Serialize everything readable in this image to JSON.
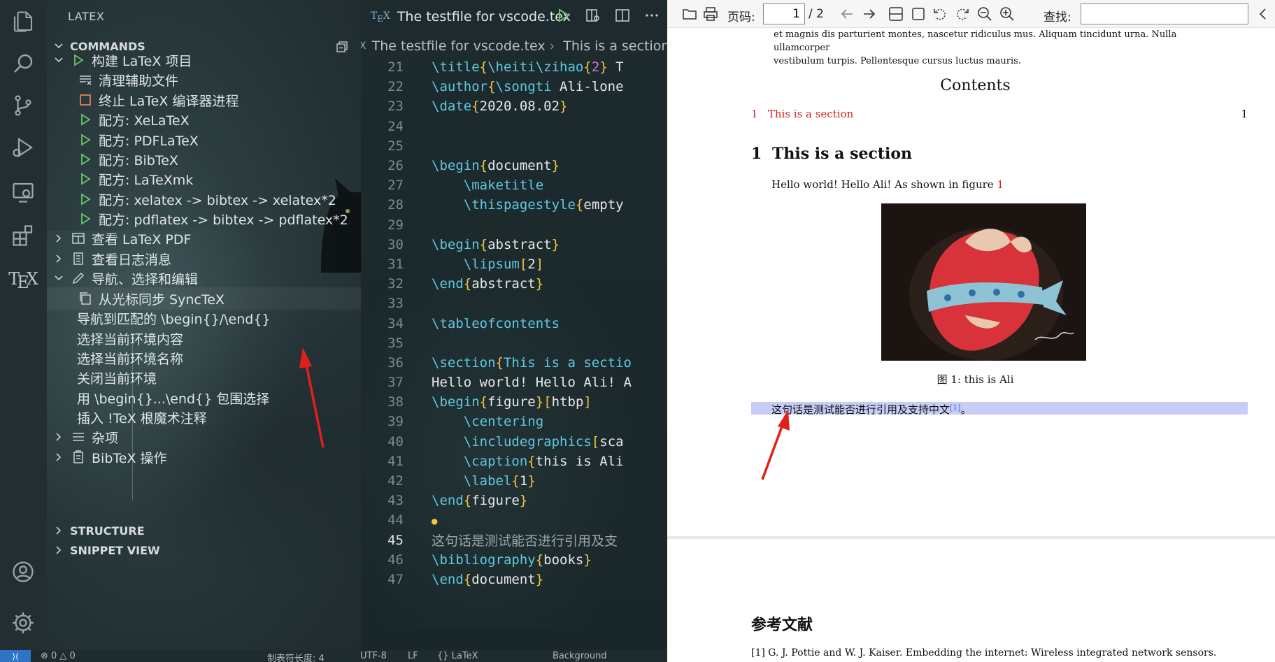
{
  "sidebar": {
    "title": "LATEX",
    "more": "···",
    "commands_header": "COMMANDS",
    "items": [
      {
        "label": "构建 LaTeX 项目"
      },
      {
        "label": "清理辅助文件"
      },
      {
        "label": "终止 LaTeX 编译器进程"
      },
      {
        "label": "配方: XeLaTeX"
      },
      {
        "label": "配方: PDFLaTeX"
      },
      {
        "label": "配方: BibTeX"
      },
      {
        "label": "配方: LaTeXmk"
      },
      {
        "label": "配方: xelatex -> bibtex -> xelatex*2"
      },
      {
        "label": "配方: pdflatex -> bibtex -> pdflatex*2"
      },
      {
        "label": "查看 LaTeX PDF"
      },
      {
        "label": "查看日志消息"
      },
      {
        "label": "导航、选择和编辑"
      },
      {
        "label": "从光标同步 SyncTeX"
      },
      {
        "label": "导航到匹配的 \\begin{}/\\end{}"
      },
      {
        "label": "选择当前环境内容"
      },
      {
        "label": "选择当前环境名称"
      },
      {
        "label": "关闭当前环境"
      },
      {
        "label": "用 \\begin{}...\\end{} 包围选择"
      },
      {
        "label": "插入 !TeX 根魔术注释"
      },
      {
        "label": "杂项"
      },
      {
        "label": "BibTeX 操作"
      }
    ],
    "structure_header": "STRUCTURE",
    "snippet_header": "SNIPPET VIEW"
  },
  "editor": {
    "tab_title": "The testfile for vscode.tex",
    "breadcrumb_file": "The testfile for vscode.tex",
    "breadcrumb_section": "This is a section",
    "lines": [
      {
        "n": "21",
        "tokens": [
          [
            "c",
            "\\title"
          ],
          [
            "b",
            "{"
          ],
          [
            "c",
            "\\heiti"
          ],
          [
            "c",
            "\\zihao"
          ],
          [
            "b",
            "{"
          ],
          [
            "p",
            "2"
          ],
          [
            "b",
            "}"
          ],
          [
            "t",
            " T"
          ]
        ]
      },
      {
        "n": "22",
        "tokens": [
          [
            "c",
            "\\author"
          ],
          [
            "b",
            "{"
          ],
          [
            "c",
            "\\songti"
          ],
          [
            "t",
            " Ali-lone"
          ]
        ]
      },
      {
        "n": "23",
        "tokens": [
          [
            "c",
            "\\date"
          ],
          [
            "b",
            "{"
          ],
          [
            "t",
            "2020.08.02"
          ],
          [
            "b",
            "}"
          ]
        ]
      },
      {
        "n": "24",
        "tokens": []
      },
      {
        "n": "25",
        "tokens": []
      },
      {
        "n": "26",
        "tokens": [
          [
            "c",
            "\\begin"
          ],
          [
            "b",
            "{"
          ],
          [
            "t",
            "document"
          ],
          [
            "b",
            "}"
          ]
        ]
      },
      {
        "n": "27",
        "tokens": [
          [
            "t",
            "    "
          ],
          [
            "c",
            "\\maketitle"
          ]
        ]
      },
      {
        "n": "28",
        "tokens": [
          [
            "t",
            "    "
          ],
          [
            "c",
            "\\thispagestyle"
          ],
          [
            "b",
            "{"
          ],
          [
            "t",
            "empty"
          ]
        ]
      },
      {
        "n": "29",
        "tokens": []
      },
      {
        "n": "30",
        "tokens": [
          [
            "c",
            "\\begin"
          ],
          [
            "b",
            "{"
          ],
          [
            "t",
            "abstract"
          ],
          [
            "b",
            "}"
          ]
        ]
      },
      {
        "n": "31",
        "tokens": [
          [
            "t",
            "    "
          ],
          [
            "c",
            "\\lipsum"
          ],
          [
            "b",
            "["
          ],
          [
            "t",
            "2"
          ],
          [
            "b",
            "]"
          ]
        ]
      },
      {
        "n": "32",
        "tokens": [
          [
            "c",
            "\\end"
          ],
          [
            "b",
            "{"
          ],
          [
            "t",
            "abstract"
          ],
          [
            "b",
            "}"
          ]
        ]
      },
      {
        "n": "33",
        "tokens": []
      },
      {
        "n": "34",
        "tokens": [
          [
            "c",
            "\\tableofcontents"
          ]
        ]
      },
      {
        "n": "35",
        "tokens": []
      },
      {
        "n": "36",
        "tokens": [
          [
            "c",
            "\\section"
          ],
          [
            "b",
            "{"
          ],
          [
            "c",
            "This is a sectio"
          ]
        ]
      },
      {
        "n": "37",
        "tokens": [
          [
            "t",
            "Hello world! Hello Ali! A"
          ]
        ]
      },
      {
        "n": "38",
        "tokens": [
          [
            "c",
            "\\begin"
          ],
          [
            "b",
            "{"
          ],
          [
            "t",
            "figure"
          ],
          [
            "b",
            "}"
          ],
          [
            "b",
            "["
          ],
          [
            "t",
            "htbp"
          ],
          [
            "b",
            "]"
          ]
        ]
      },
      {
        "n": "39",
        "tokens": [
          [
            "t",
            "    "
          ],
          [
            "c",
            "\\centering"
          ]
        ]
      },
      {
        "n": "40",
        "tokens": [
          [
            "t",
            "    "
          ],
          [
            "c",
            "\\includegraphics"
          ],
          [
            "b",
            "["
          ],
          [
            "t",
            "sca"
          ]
        ]
      },
      {
        "n": "41",
        "tokens": [
          [
            "t",
            "    "
          ],
          [
            "c",
            "\\caption"
          ],
          [
            "b",
            "{"
          ],
          [
            "t",
            "this is Ali"
          ]
        ]
      },
      {
        "n": "42",
        "tokens": [
          [
            "t",
            "    "
          ],
          [
            "c",
            "\\label"
          ],
          [
            "b",
            "{"
          ],
          [
            "t",
            "1"
          ],
          [
            "b",
            "}"
          ]
        ]
      },
      {
        "n": "43",
        "tokens": [
          [
            "c",
            "\\end"
          ],
          [
            "b",
            "{"
          ],
          [
            "t",
            "figure"
          ],
          [
            "b",
            "}"
          ]
        ]
      },
      {
        "n": "44",
        "tokens": []
      },
      {
        "n": "45",
        "tokens": [
          [
            "d",
            "这句话是测试能否进行引用及支"
          ]
        ],
        "active": true
      },
      {
        "n": "46",
        "tokens": [
          [
            "c",
            "\\bibliography"
          ],
          [
            "b",
            "{"
          ],
          [
            "t",
            "books"
          ],
          [
            "b",
            "}"
          ]
        ]
      },
      {
        "n": "47",
        "tokens": [
          [
            "c",
            "\\end"
          ],
          [
            "b",
            "{"
          ],
          [
            "t",
            "document"
          ],
          [
            "b",
            "}"
          ]
        ]
      }
    ]
  },
  "pdf": {
    "page_label": "页码:",
    "page_value": "1",
    "page_total": "/ 2",
    "find_label": "查找:",
    "top_text_1": "et magnis dis parturient montes, nascetur ridiculus mus.  Aliquam tincidunt urna.  Nulla ullamcorper",
    "top_text_2": "vestibulum turpis. Pellentesque cursus luctus mauris.",
    "contents_title": "Contents",
    "toc_num": "1",
    "toc_title": "This is a section",
    "toc_page": "1",
    "section_num": "1",
    "section_title": "This is a section",
    "hello_text": "Hello world! Hello Ali! As shown in figure",
    "hello_ref": "1",
    "figure_caption": "图 1: this is Ali",
    "cn_sentence": "这句话是测试能否进行引用及支持中文",
    "cn_cite": "[1]",
    "cn_end": "。",
    "ref_title": "参考文献",
    "ref_entry": "[1] G. J. Pottie and W. J. Kaiser.  Embedding the internet:  Wireless integrated network sensors."
  },
  "statusbar": {
    "remote": "⟩⟨",
    "problems": "⊗ 0 △ 0",
    "indent": "制表符长度: 4",
    "encoding": "UTF-8",
    "eol": "LF",
    "language": "{} LaTeX",
    "background": "Background"
  },
  "colors": {
    "accent_blue": "#2f73c4",
    "link_red": "#d61f1f",
    "highlight": "#c7cdf7",
    "arrow_red": "#e0201c"
  }
}
